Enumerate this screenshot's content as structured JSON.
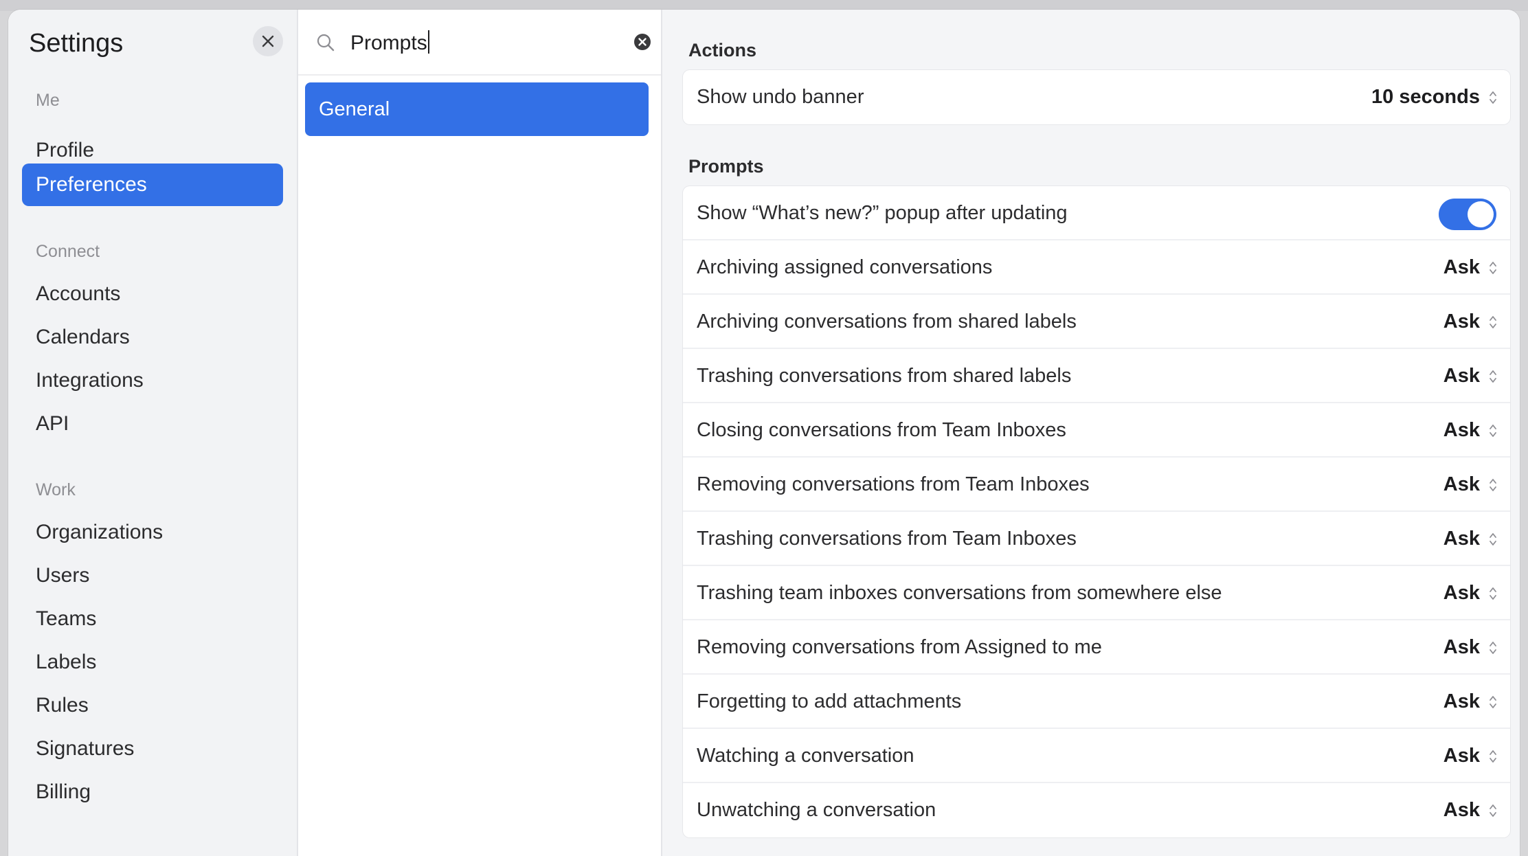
{
  "sidebar": {
    "title": "Settings",
    "sections": [
      {
        "label": "Me",
        "items": [
          "Profile",
          "Preferences"
        ]
      },
      {
        "label": "Connect",
        "items": [
          "Accounts",
          "Calendars",
          "Integrations",
          "API"
        ]
      },
      {
        "label": "Work",
        "items": [
          "Organizations",
          "Users",
          "Teams",
          "Labels",
          "Rules",
          "Signatures",
          "Billing"
        ]
      }
    ],
    "active_item": "Preferences"
  },
  "search": {
    "value": "Prompts",
    "results": [
      "General"
    ]
  },
  "actions": {
    "title": "Actions",
    "rows": [
      {
        "label": "Show undo banner",
        "value": "10 seconds"
      }
    ]
  },
  "prompts": {
    "title": "Prompts",
    "toggle_row": {
      "label": "Show “What’s new?” popup after updating",
      "enabled": true
    },
    "rows": [
      {
        "label": "Archiving assigned conversations",
        "value": "Ask"
      },
      {
        "label": "Archiving conversations from shared labels",
        "value": "Ask"
      },
      {
        "label": "Trashing conversations from shared labels",
        "value": "Ask"
      },
      {
        "label": "Closing conversations from Team Inboxes",
        "value": "Ask"
      },
      {
        "label": "Removing conversations from Team Inboxes",
        "value": "Ask"
      },
      {
        "label": "Trashing conversations from Team Inboxes",
        "value": "Ask"
      },
      {
        "label": "Trashing team inboxes conversations from somewhere else",
        "value": "Ask"
      },
      {
        "label": "Removing conversations from Assigned to me",
        "value": "Ask"
      },
      {
        "label": "Forgetting to add attachments",
        "value": "Ask"
      },
      {
        "label": "Watching a conversation",
        "value": "Ask"
      },
      {
        "label": "Unwatching a conversation",
        "value": "Ask"
      }
    ]
  },
  "colors": {
    "accent": "#3370e6",
    "background": "#f4f5f7",
    "text": "#2c2c2e",
    "muted": "#8e8e93"
  },
  "icons": {
    "close": "close-icon",
    "search": "search-icon",
    "clear": "clear-search-icon",
    "stepper": "up-down-chevron-icon"
  }
}
